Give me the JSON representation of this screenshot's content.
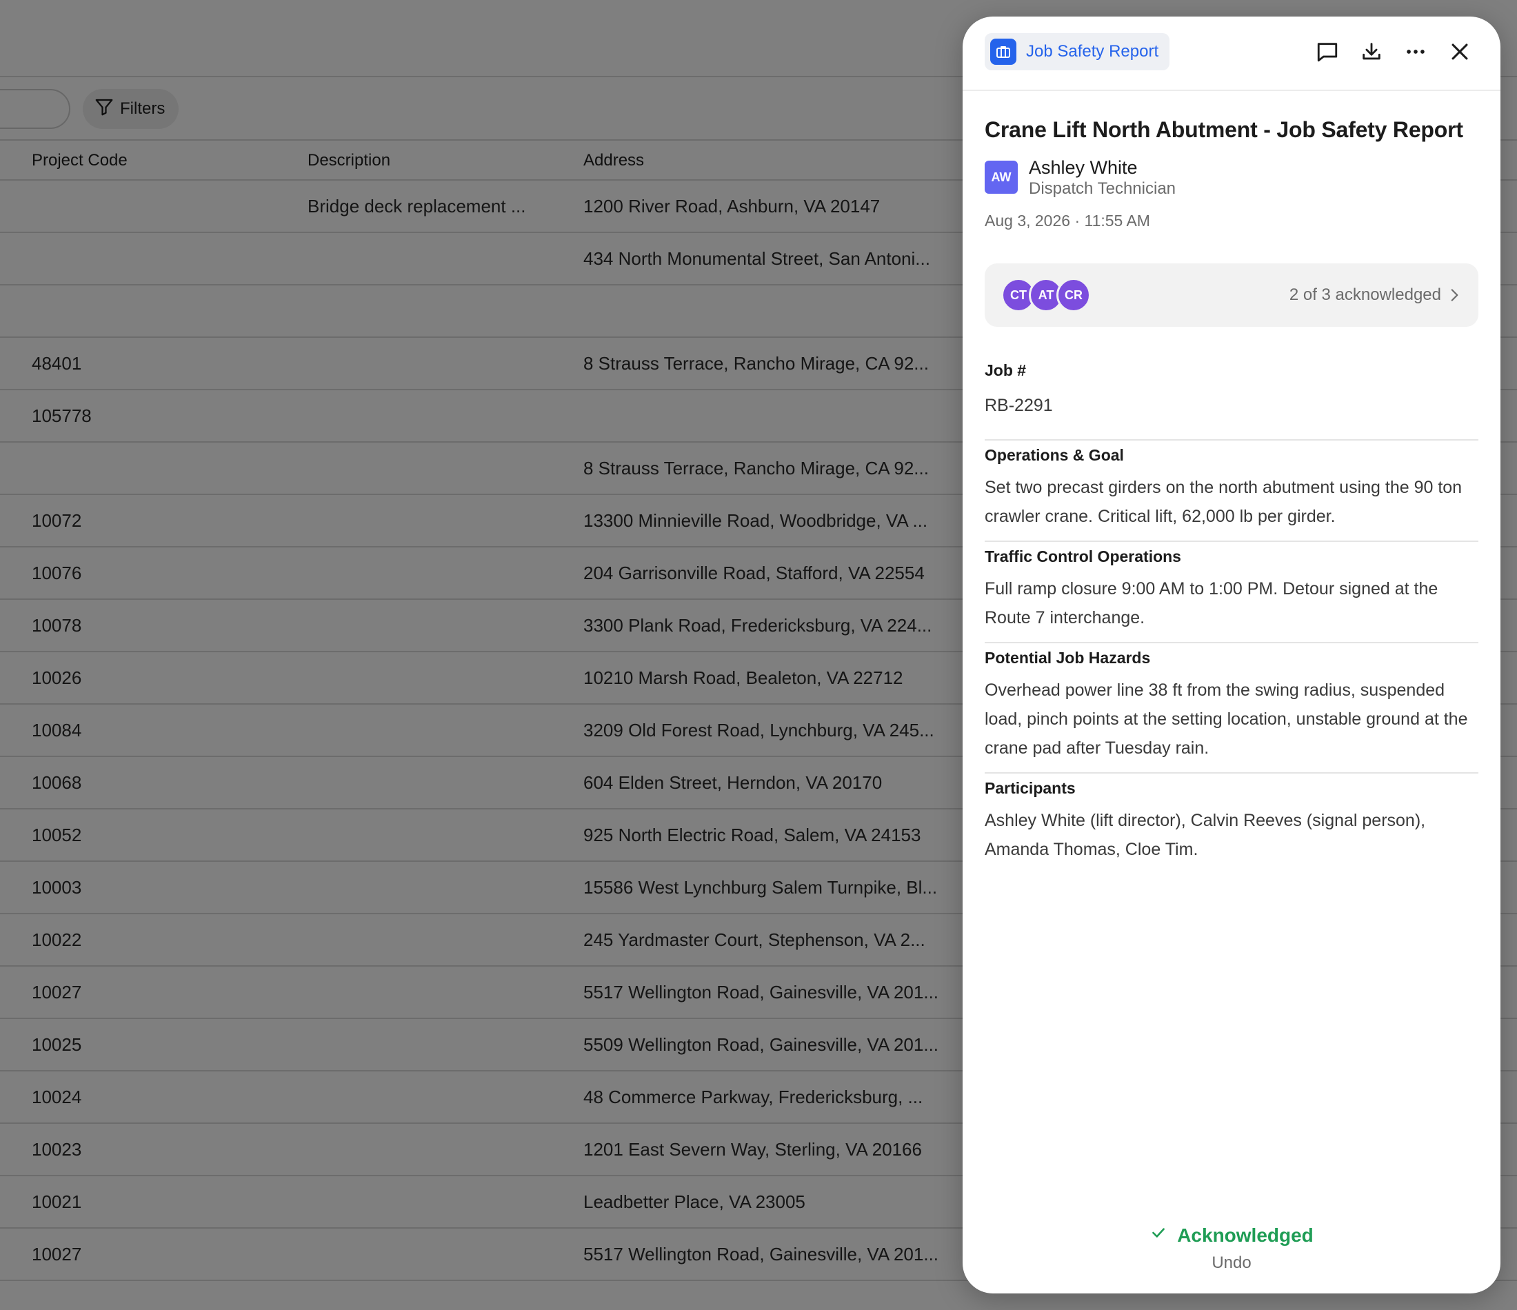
{
  "toolbar": {
    "filters_label": "Filters"
  },
  "table": {
    "headers": {
      "project_code": "Project Code",
      "description": "Description",
      "address": "Address"
    },
    "rows": [
      {
        "code": "",
        "description": "Bridge deck replacement ...",
        "address": "1200 River Road, Ashburn, VA 20147"
      },
      {
        "code": "",
        "description": "",
        "address": "434 North Monumental Street, San Antoni..."
      },
      {
        "code": "",
        "description": "",
        "address": ""
      },
      {
        "code": "48401",
        "description": "",
        "address": "8 Strauss Terrace, Rancho Mirage, CA 92..."
      },
      {
        "code": "105778",
        "description": "",
        "address": ""
      },
      {
        "code": "",
        "description": "",
        "address": "8 Strauss Terrace, Rancho Mirage, CA 92..."
      },
      {
        "code": "10072",
        "description": "",
        "address": "13300 Minnieville Road, Woodbridge, VA ..."
      },
      {
        "code": "10076",
        "description": "",
        "address": "204 Garrisonville Road, Stafford, VA 22554"
      },
      {
        "code": "10078",
        "description": "",
        "address": "3300 Plank Road, Fredericksburg, VA 224..."
      },
      {
        "code": "10026",
        "description": "",
        "address": "10210 Marsh Road, Bealeton, VA 22712"
      },
      {
        "code": "10084",
        "description": "",
        "address": "3209 Old Forest Road, Lynchburg, VA 245..."
      },
      {
        "code": "10068",
        "description": "",
        "address": "604 Elden Street, Herndon, VA 20170"
      },
      {
        "code": "10052",
        "description": "",
        "address": "925 North Electric Road, Salem, VA 24153"
      },
      {
        "code": "10003",
        "description": "",
        "address": "15586 West Lynchburg Salem Turnpike, Bl..."
      },
      {
        "code": "10022",
        "description": "",
        "address": "245 Yardmaster Court, Stephenson, VA 2..."
      },
      {
        "code": "10027",
        "description": "",
        "address": "5517 Wellington Road, Gainesville, VA 201..."
      },
      {
        "code": "10025",
        "description": "",
        "address": "5509 Wellington Road, Gainesville, VA 201..."
      },
      {
        "code": "10024",
        "description": "",
        "address": "48 Commerce Parkway, Fredericksburg, ..."
      },
      {
        "code": "10023",
        "description": "",
        "address": "1201 East Severn Way, Sterling, VA 20166"
      },
      {
        "code": "10021",
        "description": "",
        "address": "Leadbetter Place, VA 23005"
      },
      {
        "code": "10027",
        "description": "",
        "address": "5517 Wellington Road, Gainesville, VA 201..."
      }
    ]
  },
  "drawer": {
    "type_label": "Job Safety Report",
    "type_icon": "briefcase-icon",
    "header_icons": [
      "comment-icon",
      "download-icon",
      "more-icon",
      "close-icon"
    ],
    "title": "Crane Lift North Abutment - Job Safety Report",
    "author": {
      "initials": "AW",
      "name": "Ashley White",
      "role": "Dispatch Technician"
    },
    "date": "Aug 3, 2026 · 11:55 AM",
    "acknowledgement": {
      "avatars": [
        "CT",
        "AT",
        "CR"
      ],
      "summary": "2 of 3 acknowledged"
    },
    "fields": [
      {
        "label": "Job #",
        "value": "RB-2291"
      },
      {
        "label": "Operations & Goal",
        "value": "Set two precast girders on the north abutment using the 90 ton crawler crane. Critical lift, 62,000 lb per girder."
      },
      {
        "label": "Traffic Control Operations",
        "value": "Full ramp closure 9:00 AM to 1:00 PM. Detour signed at the Route 7 interchange."
      },
      {
        "label": "Potential Job Hazards",
        "value": "Overhead power line 38 ft from the swing radius, suspended load, pinch points at the setting location, unstable ground at the crane pad after Tuesday rain."
      },
      {
        "label": "Participants",
        "value": "Ashley White (lift director), Calvin Reeves (signal person), Amanda Thomas, Cloe Tim."
      }
    ],
    "footer": {
      "status": "Acknowledged",
      "undo": "Undo"
    }
  },
  "colors": {
    "accent": "#2563eb",
    "success": "#1f9d55",
    "avatar": "#7c4dde",
    "author_avatar": "#6366f1"
  }
}
